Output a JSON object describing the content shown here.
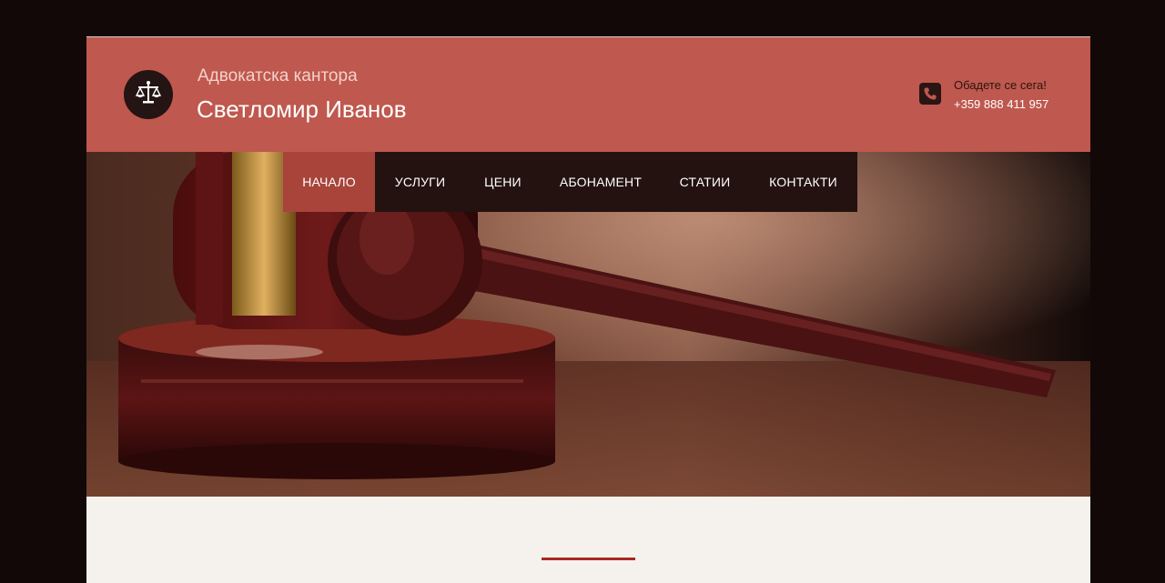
{
  "header": {
    "brand_subtitle": "Адвокатска кантора",
    "brand_name": "Светломир Иванов",
    "call_label": "Обадете се сега!",
    "phone_number": "+359 888 411 957",
    "logo_icon": "scales-of-justice-icon",
    "phone_icon": "phone-icon"
  },
  "nav": {
    "items": [
      {
        "label": "НАЧАЛО",
        "active": true
      },
      {
        "label": "УСЛУГИ",
        "active": false
      },
      {
        "label": "ЦЕНИ",
        "active": false
      },
      {
        "label": "АБОНАМЕНТ",
        "active": false
      },
      {
        "label": "СТАТИИ",
        "active": false
      },
      {
        "label": "КОНТАКТИ",
        "active": false
      }
    ]
  },
  "colors": {
    "header_bg": "#bf584e",
    "nav_bg": "#241211",
    "nav_active": "#a8443a",
    "divider": "#a8281f",
    "page_bg": "#f5f1ed",
    "outer_bg": "#120807"
  }
}
